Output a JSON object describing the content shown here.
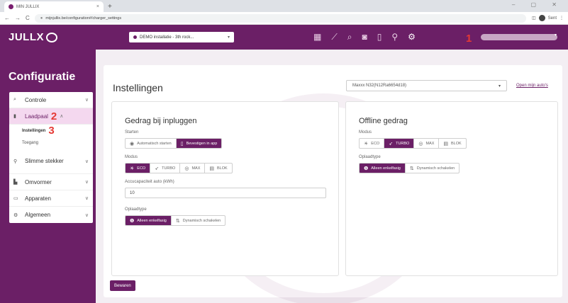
{
  "browser": {
    "tab_title": "MIN JULLIX",
    "tab_close": "×",
    "new_tab": "+",
    "window_controls": "– ▢ ✕",
    "back": "←",
    "forward": "→",
    "reload": "C",
    "url": "mijnjullix.be/configuration#/charger_settings",
    "profile_label": "Sent"
  },
  "header": {
    "logo": "JULLX",
    "installation_select": "DEMO installatie - 3th rock...",
    "marker": "1"
  },
  "sidebar": {
    "title": "Configuratie",
    "items": [
      {
        "label": "Controle",
        "icon": "search-icon"
      },
      {
        "label": "Laadpaal",
        "marker": "2"
      },
      {
        "label": "Slimme stekker"
      },
      {
        "label": "Omvormer"
      },
      {
        "label": "Apparaten"
      },
      {
        "label": "Algemeen"
      }
    ],
    "sub_items": [
      {
        "label": "Instellingen",
        "marker": "3"
      },
      {
        "label": "Toegang"
      }
    ]
  },
  "main": {
    "title": "Instellingen",
    "charger_select": "Maxxx N32(N12Ra6654d18)",
    "other_link": "Open mijn auto's",
    "plugin_panel": {
      "title": "Gedrag bij inpluggen",
      "start_label": "Starten",
      "start_options": [
        "Automatisch starten",
        "Bevestigen in app"
      ],
      "mode_label": "Modus",
      "mode_options": [
        "ECO",
        "TURBO",
        "MAX",
        "BLOK"
      ],
      "battery_label": "Accucapaciteit auto (kWh)",
      "battery_value": "10",
      "charge_type_label": "Oplaadtype",
      "charge_type_options": [
        "Alleen enkelfasig",
        "Dynamisch schakelen"
      ]
    },
    "offline_panel": {
      "title": "Offline gedrag",
      "mode_label": "Modus",
      "mode_options": [
        "ECO",
        "TURBO",
        "MAX",
        "BLOK"
      ],
      "charge_type_label": "Oplaadtype",
      "charge_type_options": [
        "Alleen enkelfasig",
        "Dynamisch schakelen"
      ]
    },
    "save_label": "Bewaren"
  }
}
